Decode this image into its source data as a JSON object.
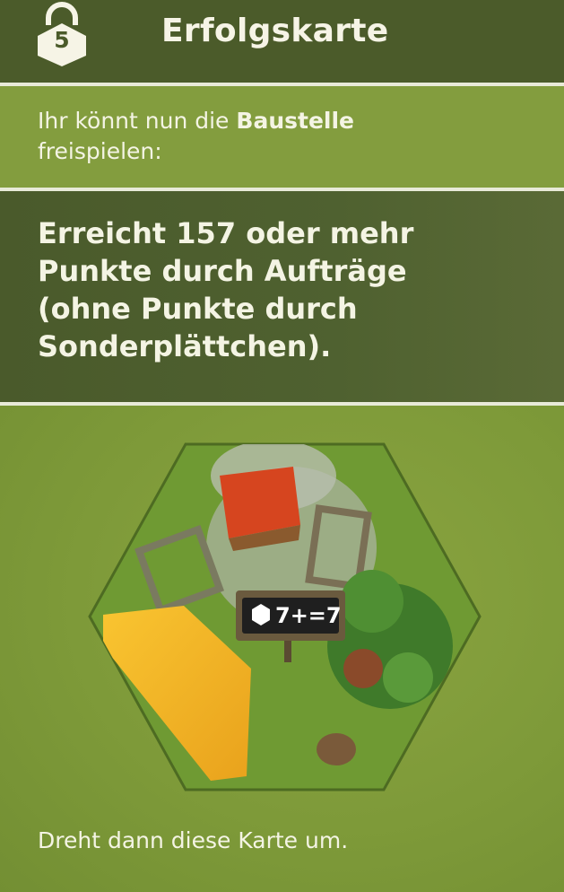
{
  "header": {
    "lock_number": "5",
    "title": "Erfolgskarte"
  },
  "intro": {
    "text_before": "Ihr könnt nun die ",
    "highlight": "Baustelle",
    "text_after": " freispielen:"
  },
  "goal": {
    "line1": "Erreicht 157 oder mehr",
    "line2": "Punkte durch Aufträge",
    "line3": "(ohne Punkte durch",
    "line4": "Sonderplättchen)."
  },
  "tile": {
    "sign_text": "7+=7"
  },
  "footer": {
    "text": "Dreht dann diese Karte um."
  },
  "colors": {
    "header_bg": "#4b5b2a",
    "band_light": "#839d3e",
    "text": "#f4f4e4"
  },
  "icons": [
    "lock-icon",
    "hexagon-tile-icon"
  ]
}
